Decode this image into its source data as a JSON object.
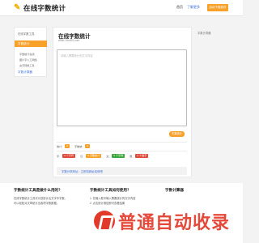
{
  "header": {
    "logo_icon": "✎",
    "logo_text": "在线字数统计",
    "nav": [
      {
        "label": "首页"
      },
      {
        "label": "了解更多"
      }
    ],
    "cta_label": "自动下载软件"
  },
  "sidebar": {
    "title": "在线字数工具",
    "active_item": "字数统计",
    "sub_items": [
      "字数统计在线",
      "图片字人工网络",
      "文字转换工具"
    ],
    "other_item": "字数计算器"
  },
  "main": {
    "title": "在线字数统计",
    "url": "www.15xx00.com",
    "textarea_placeholder": "请输入需要统计的文字内容",
    "count_button": "字数统计",
    "stats_row1": [
      {
        "label": "统计：",
        "value": "0",
        "color": "orange"
      },
      {
        "label": "字数统：",
        "value": "0",
        "color": "orange"
      }
    ],
    "stats_row2": [
      {
        "label": "字：",
        "value": "0 个字符",
        "color": "red"
      },
      {
        "label": "汉：",
        "value": "0 字数统计",
        "color": "orange"
      },
      {
        "label": "文：",
        "value": "0 个字母",
        "color": "green"
      },
      {
        "label": "数：",
        "value": "0 个数字",
        "color": "red"
      }
    ],
    "copy_text": "字数分享网址：立即将网址给他吧"
  },
  "right_note": "字数计算器",
  "bottom": {
    "col1": {
      "title": "字数统计工具是做什么用的？",
      "lines": [
        "在线字数统计工具可为您统计出文字中字数、",
        "可以轻松对文章统计出各项字数数据。"
      ]
    },
    "col2": {
      "title": "字数统计工具如何使用？",
      "lines": [
        "1. 在输入框中输入需要统计的文字内容",
        "2. 点击统计按钮即可查看结果"
      ]
    },
    "col3": {
      "title": "字数计算器",
      "lines": []
    }
  },
  "watermark": "普通自动收录",
  "colors": {
    "accent": "#f7a12b",
    "link": "#3a6fd8",
    "green": "#3ca83c",
    "red": "#e04b3a"
  }
}
